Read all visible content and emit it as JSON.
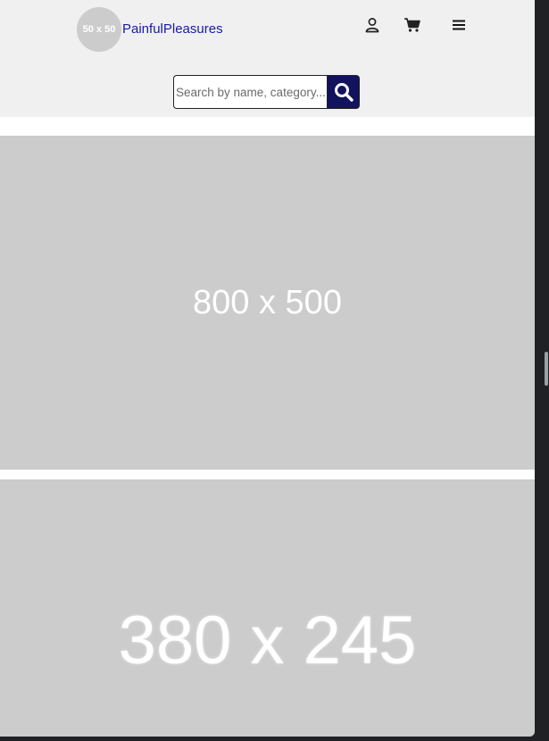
{
  "header": {
    "logo_placeholder": "50 x 50",
    "brand_name": "PainfulPleasures",
    "icons": [
      "user-icon",
      "cart-icon",
      "menu-icon"
    ]
  },
  "search": {
    "placeholder": "Search by name, category...",
    "button_icon": "search-icon"
  },
  "hero": {
    "placeholder_text": "800 x 500"
  },
  "card": {
    "placeholder_text": "380 x 245"
  },
  "colors": {
    "header_bg": "#f0f0f0",
    "brand_text": "#1a1aaa",
    "search_button_bg": "#12125e",
    "placeholder_bg": "#cccccc"
  }
}
